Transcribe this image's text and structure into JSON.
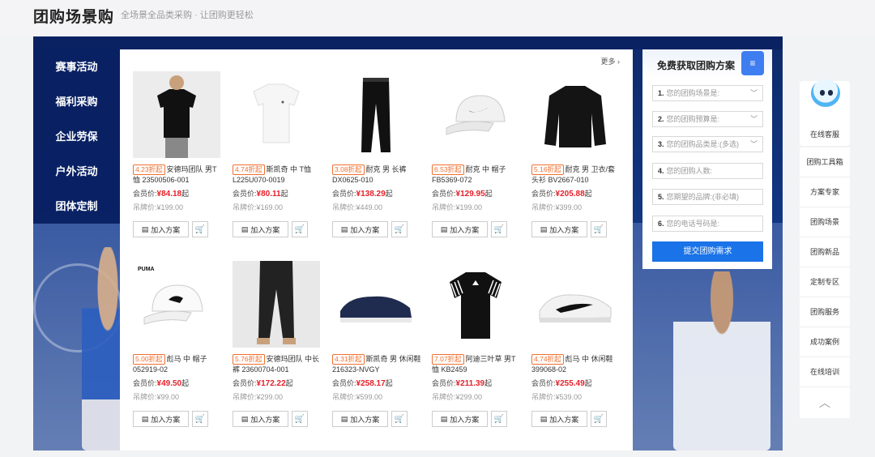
{
  "header": {
    "title": "团购场景购",
    "subtitle": "全场景全品类采购 · 让团购更轻松"
  },
  "categories": [
    {
      "label": "赛事活动",
      "active": true
    },
    {
      "label": "福利采购",
      "active": false
    },
    {
      "label": "企业劳保",
      "active": false
    },
    {
      "label": "户外活动",
      "active": false
    },
    {
      "label": "团体定制",
      "active": false
    }
  ],
  "more_label": "更多",
  "member_label": "会员价:",
  "tag_label": "吊牌价:",
  "add_plan_label": "加入方案",
  "products": [
    {
      "discount": "4.23折起",
      "name": "安德玛团队 男T恤 23500506-001",
      "member_price": "¥84.18",
      "suffix": "起",
      "tag_price": "¥199.00",
      "image": "black-tshirt"
    },
    {
      "discount": "4.74折起",
      "name": "斯凯奇 中 T恤 L225U070-0019",
      "member_price": "¥80.11",
      "suffix": "起",
      "tag_price": "¥169.00",
      "image": "white-tshirt"
    },
    {
      "discount": "3.08折起",
      "name": "耐克 男 长裤 DX0625-010",
      "member_price": "¥138.29",
      "suffix": "起",
      "tag_price": "¥449.00",
      "image": "black-pants"
    },
    {
      "discount": "6.53折起",
      "name": "耐克 中 帽子 FB5369-072",
      "member_price": "¥129.95",
      "suffix": "起",
      "tag_price": "¥199.00",
      "image": "white-cap"
    },
    {
      "discount": "5.16折起",
      "name": "耐克 男 卫衣/套头衫 BV2667-010",
      "member_price": "¥205.88",
      "suffix": "起",
      "tag_price": "¥399.00",
      "image": "black-sweater"
    },
    {
      "discount": "5.00折起",
      "name": "彪马 中 帽子 052919-02",
      "member_price": "¥49.50",
      "suffix": "起",
      "tag_price": "¥99.00",
      "image": "puma-cap"
    },
    {
      "discount": "5.76折起",
      "name": "安德玛团队 中长裤 23600704-001",
      "member_price": "¥172.22",
      "suffix": "起",
      "tag_price": "¥299.00",
      "image": "jogger-pants"
    },
    {
      "discount": "4.31折起",
      "name": "斯凯奇 男 休闲鞋 216323-NVGY",
      "member_price": "¥258.17",
      "suffix": "起",
      "tag_price": "¥599.00",
      "image": "navy-shoe"
    },
    {
      "discount": "7.07折起",
      "name": "阿迪三叶草 男T恤 KB2459",
      "member_price": "¥211.39",
      "suffix": "起",
      "tag_price": "¥299.00",
      "image": "adidas-tshirt"
    },
    {
      "discount": "4.74折起",
      "name": "彪马 中 休闲鞋 399068-02",
      "member_price": "¥255.49",
      "suffix": "起",
      "tag_price": "¥539.00",
      "image": "white-sneaker"
    }
  ],
  "form": {
    "title": "免费获取团购方案",
    "badge": "≡",
    "fields": [
      {
        "num": "1.",
        "placeholder": "您的团购场景是:",
        "dropdown": true
      },
      {
        "num": "2.",
        "placeholder": "您的团购预算是:",
        "dropdown": true
      },
      {
        "num": "3.",
        "placeholder": "您的团购品类是:(多选)",
        "dropdown": true
      },
      {
        "num": "4.",
        "placeholder": "您的团购人数:",
        "dropdown": false
      },
      {
        "num": "5.",
        "placeholder": "您期望的品牌:(非必填)",
        "dropdown": false
      },
      {
        "num": "6.",
        "placeholder": "您的电话号码是:",
        "dropdown": false
      }
    ],
    "submit_label": "提交团购需求"
  },
  "rail": {
    "service_label": "在线客服",
    "items": [
      "团购工具箱",
      "方案专家",
      "团购场景",
      "团购新品",
      "定制专区",
      "团购服务",
      "成功案例",
      "在线培训"
    ],
    "up_icon": "︿"
  }
}
